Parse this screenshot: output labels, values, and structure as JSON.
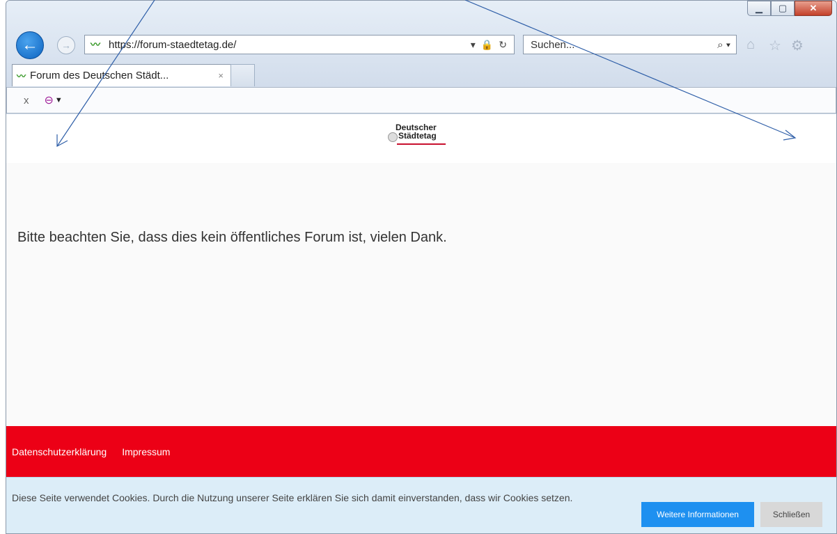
{
  "browser": {
    "address_url": "https://forum-staedtetag.de/",
    "search_placeholder": "Suchen...",
    "tab_title": "Forum des Deutschen Städt...",
    "tab_close": "×",
    "toolbar_close": "x"
  },
  "page": {
    "logo_line1": "Deutscher",
    "logo_line2": "Städtetag",
    "notice": "Bitte beachten Sie, dass dies kein öffentliches Forum ist, vielen Dank.",
    "footer_links": [
      "Datenschutzerklärung",
      "Impressum"
    ]
  },
  "cookie_banner": {
    "text": "Diese Seite verwendet Cookies. Durch die Nutzung unserer Seite erklären Sie sich damit einverstanden, dass wir Cookies setzen.",
    "more_info_label": "Weitere Informationen",
    "close_label": "Schließen"
  },
  "colors": {
    "footer_red": "#ec0016",
    "cookie_bg": "#dcedf8",
    "more_button_blue": "#1e90f0",
    "annotation_arrow": "#2f5fa8"
  }
}
